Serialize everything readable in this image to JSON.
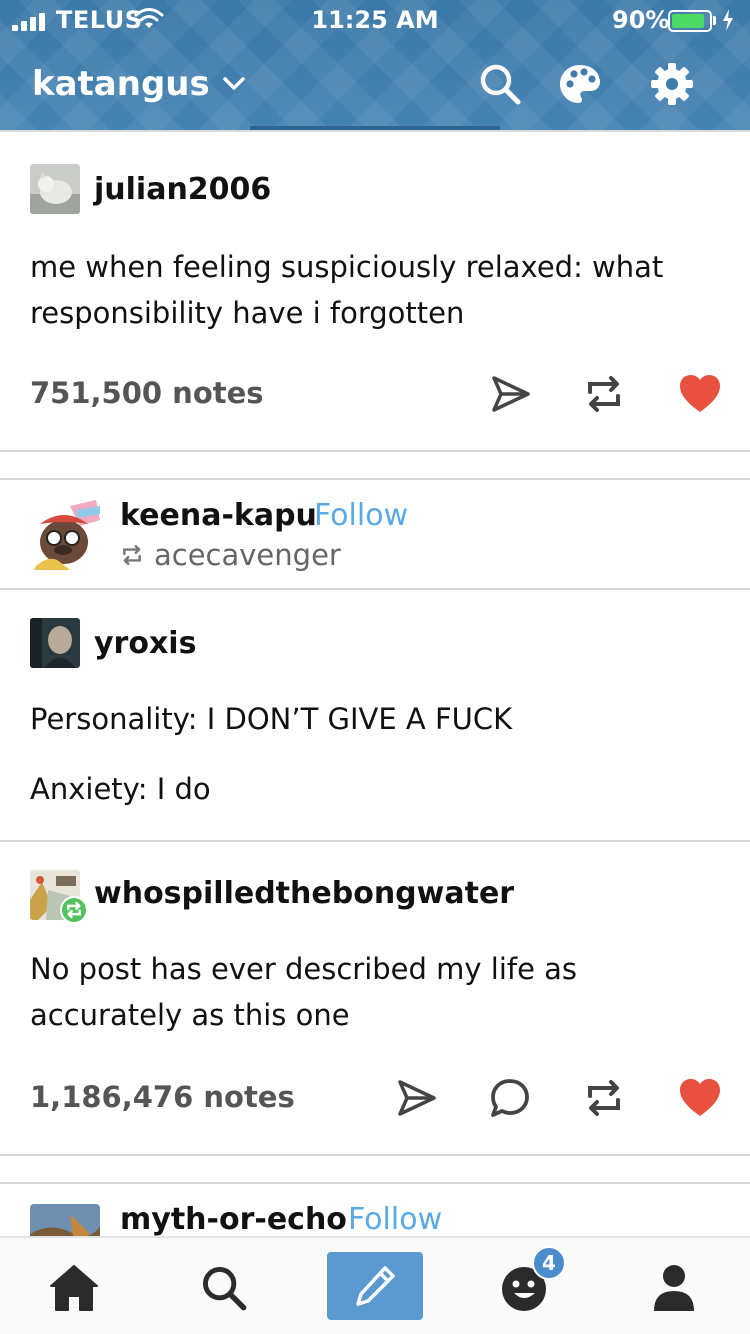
{
  "status_bar": {
    "carrier": "TELUS",
    "time": "11:25 AM",
    "battery_percent": "90%",
    "battery_level": 0.9
  },
  "header": {
    "blog_name": "katangus",
    "icons": [
      "chevron-down-icon",
      "search-icon",
      "palette-icon",
      "gear-icon"
    ]
  },
  "posts": [
    {
      "author": "julian2006",
      "text": "me when feeling suspiciously relaxed: what responsibility have i forgotten",
      "notes": "751,500 notes",
      "actions": [
        "share-icon",
        "reblog-icon",
        "heart-icon"
      ]
    },
    {
      "author": "keena-kapu",
      "follow_label": "Follow",
      "reblogged_from": "acecavenger",
      "thread": [
        {
          "author": "yroxis",
          "paragraphs": [
            "Personality: I DON’T GIVE A FUCK",
            "Anxiety: I do"
          ]
        },
        {
          "author": "whospilledthebongwater",
          "paragraphs": [
            "No post has ever described my life as accurately as this one"
          ]
        }
      ],
      "notes": "1,186,476 notes",
      "actions": [
        "share-icon",
        "reply-icon",
        "reblog-icon",
        "heart-icon"
      ]
    },
    {
      "author": "myth-or-echo",
      "follow_label": "Follow"
    }
  ],
  "bottom_nav": {
    "items": [
      "home-icon",
      "search-icon",
      "compose-icon",
      "activity-icon",
      "account-icon"
    ],
    "activity_badge": "4"
  },
  "colors": {
    "header_blue": "#3b79a9",
    "link_blue": "#5aa9e6",
    "heart_red": "#e9503f",
    "reblog_green": "#54c15f",
    "compose_blue": "#5a9ad1"
  }
}
